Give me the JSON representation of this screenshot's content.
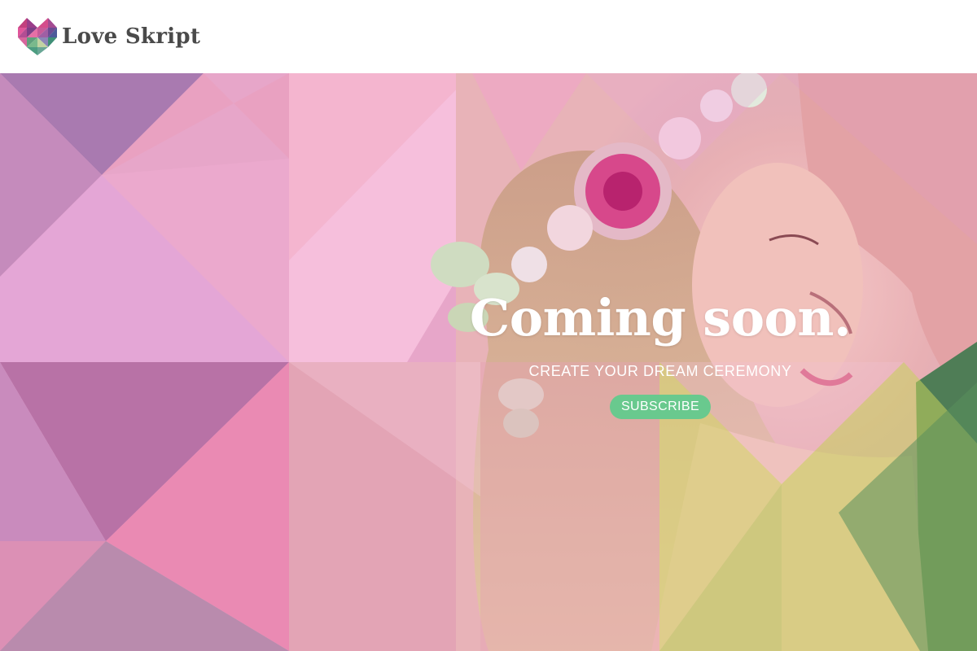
{
  "brand": {
    "name": "Love Skript",
    "logo_icon": "heart-mosaic-icon"
  },
  "hero": {
    "title": "Coming soon.",
    "subtitle": "CREATE YOUR DREAM CEREMONY",
    "cta_label": "SUBSCRIBE",
    "image": "couple-photo"
  },
  "colors": {
    "header_bg": "#ffffff",
    "brand_text": "#4a4a4a",
    "cta_bg": "#69c98e",
    "hero_text": "#ffffff"
  }
}
